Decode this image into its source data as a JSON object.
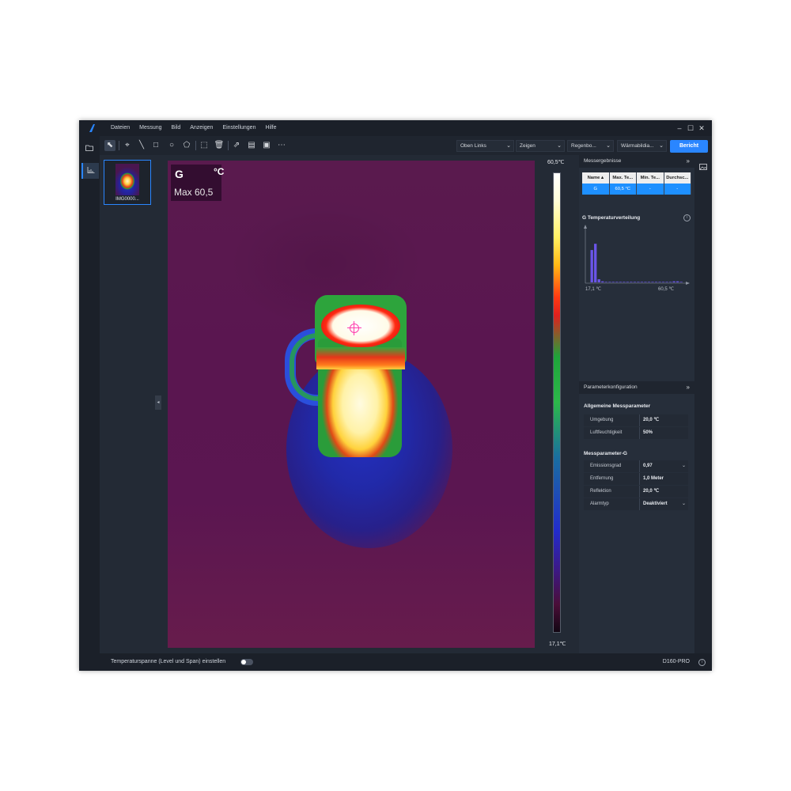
{
  "menu": [
    "Dateien",
    "Messung",
    "Bild",
    "Anzeigen",
    "Einstellungen",
    "Hilfe"
  ],
  "window_controls": {
    "minimize": "–",
    "maximize": "☐",
    "close": "✕"
  },
  "toolbar": {
    "dropdowns": [
      "Oben Links",
      "Zeigen",
      "Regenbo...",
      "Wärmabildia..."
    ],
    "report_button": "Bericht"
  },
  "thumbnail": {
    "label": "IMG0000..."
  },
  "overlay": {
    "name": "G",
    "unit": "°C",
    "max": "Max 60,5"
  },
  "scale": {
    "max": "60,5℃",
    "min": "17,1℃"
  },
  "results": {
    "title": "Messergebnisse",
    "headers": [
      "Name ▴",
      "Max. Te...",
      "Min. Te...",
      "Durchsc..."
    ],
    "rows": [
      [
        "G",
        "60,5 °C",
        "-",
        "-"
      ]
    ]
  },
  "distribution": {
    "title": "G Temperaturverteilung",
    "min_label": "17,1 ℃",
    "max_label": "60,5 ℃",
    "bins": [
      0.0,
      0.62,
      0.74,
      0.06,
      0.02,
      0.01,
      0.01,
      0.01,
      0.01,
      0.01,
      0.01,
      0.01,
      0.01,
      0.01,
      0.01,
      0.01,
      0.01,
      0.01,
      0.01,
      0.01,
      0.01,
      0.01,
      0.01,
      0.01,
      0.02,
      0.02,
      0.01
    ]
  },
  "params": {
    "title": "Parameterkonfiguration",
    "general_title": "Allgemeine Messparameter",
    "general": [
      {
        "label": "Umgebung",
        "value": "20,0 ℃"
      },
      {
        "label": "Luftfeuchtigkeit",
        "value": "50%"
      }
    ],
    "g_title": "Messparameter-G",
    "g": [
      {
        "label": "Emissionsgrad",
        "value": "0,97"
      },
      {
        "label": "Entfernung",
        "value": "1,0 Meter"
      },
      {
        "label": "Reflektion",
        "value": "20,0 ℃"
      },
      {
        "label": "Alarmtyp",
        "value": "Deaktiviert"
      }
    ]
  },
  "statusbar": {
    "label": "Temperaturspanne (Level und Span) einstellen",
    "device": "D160-PRO"
  },
  "colors": {
    "accent": "#2a86ff",
    "bg": "#232a35"
  }
}
